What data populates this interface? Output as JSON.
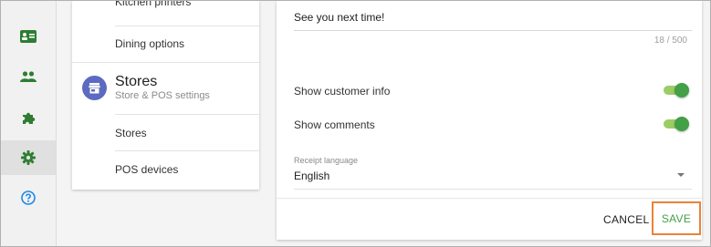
{
  "rail": {
    "items": [
      {
        "icon": "id-card-icon",
        "active": false
      },
      {
        "icon": "people-icon",
        "active": false
      },
      {
        "icon": "puzzle-icon",
        "active": false
      },
      {
        "icon": "gear-icon",
        "active": true
      },
      {
        "icon": "help-circle-icon",
        "active": false
      }
    ]
  },
  "settings_nav": {
    "kitchen_printers": "Kitchen printers",
    "dining_options": "Dining options",
    "stores_section": {
      "icon": "store-icon",
      "title": "Stores",
      "subtitle": "Store & POS settings"
    },
    "stores": "Stores",
    "pos_devices": "POS devices"
  },
  "receipt": {
    "footer_text": "See you next time!",
    "footer_counter": "18 / 500",
    "show_customer_info": {
      "label": "Show customer info",
      "on": true
    },
    "show_comments": {
      "label": "Show comments",
      "on": true
    },
    "language": {
      "label": "Receipt language",
      "value": "English"
    }
  },
  "actions": {
    "cancel": "CANCEL",
    "save": "SAVE"
  },
  "colors": {
    "accent_green": "#43a047",
    "rail_icon_green": "#2e7d32",
    "help_blue": "#1e88e5",
    "store_icon_bg": "#5c6bc0",
    "highlight_orange": "#e8833a"
  }
}
